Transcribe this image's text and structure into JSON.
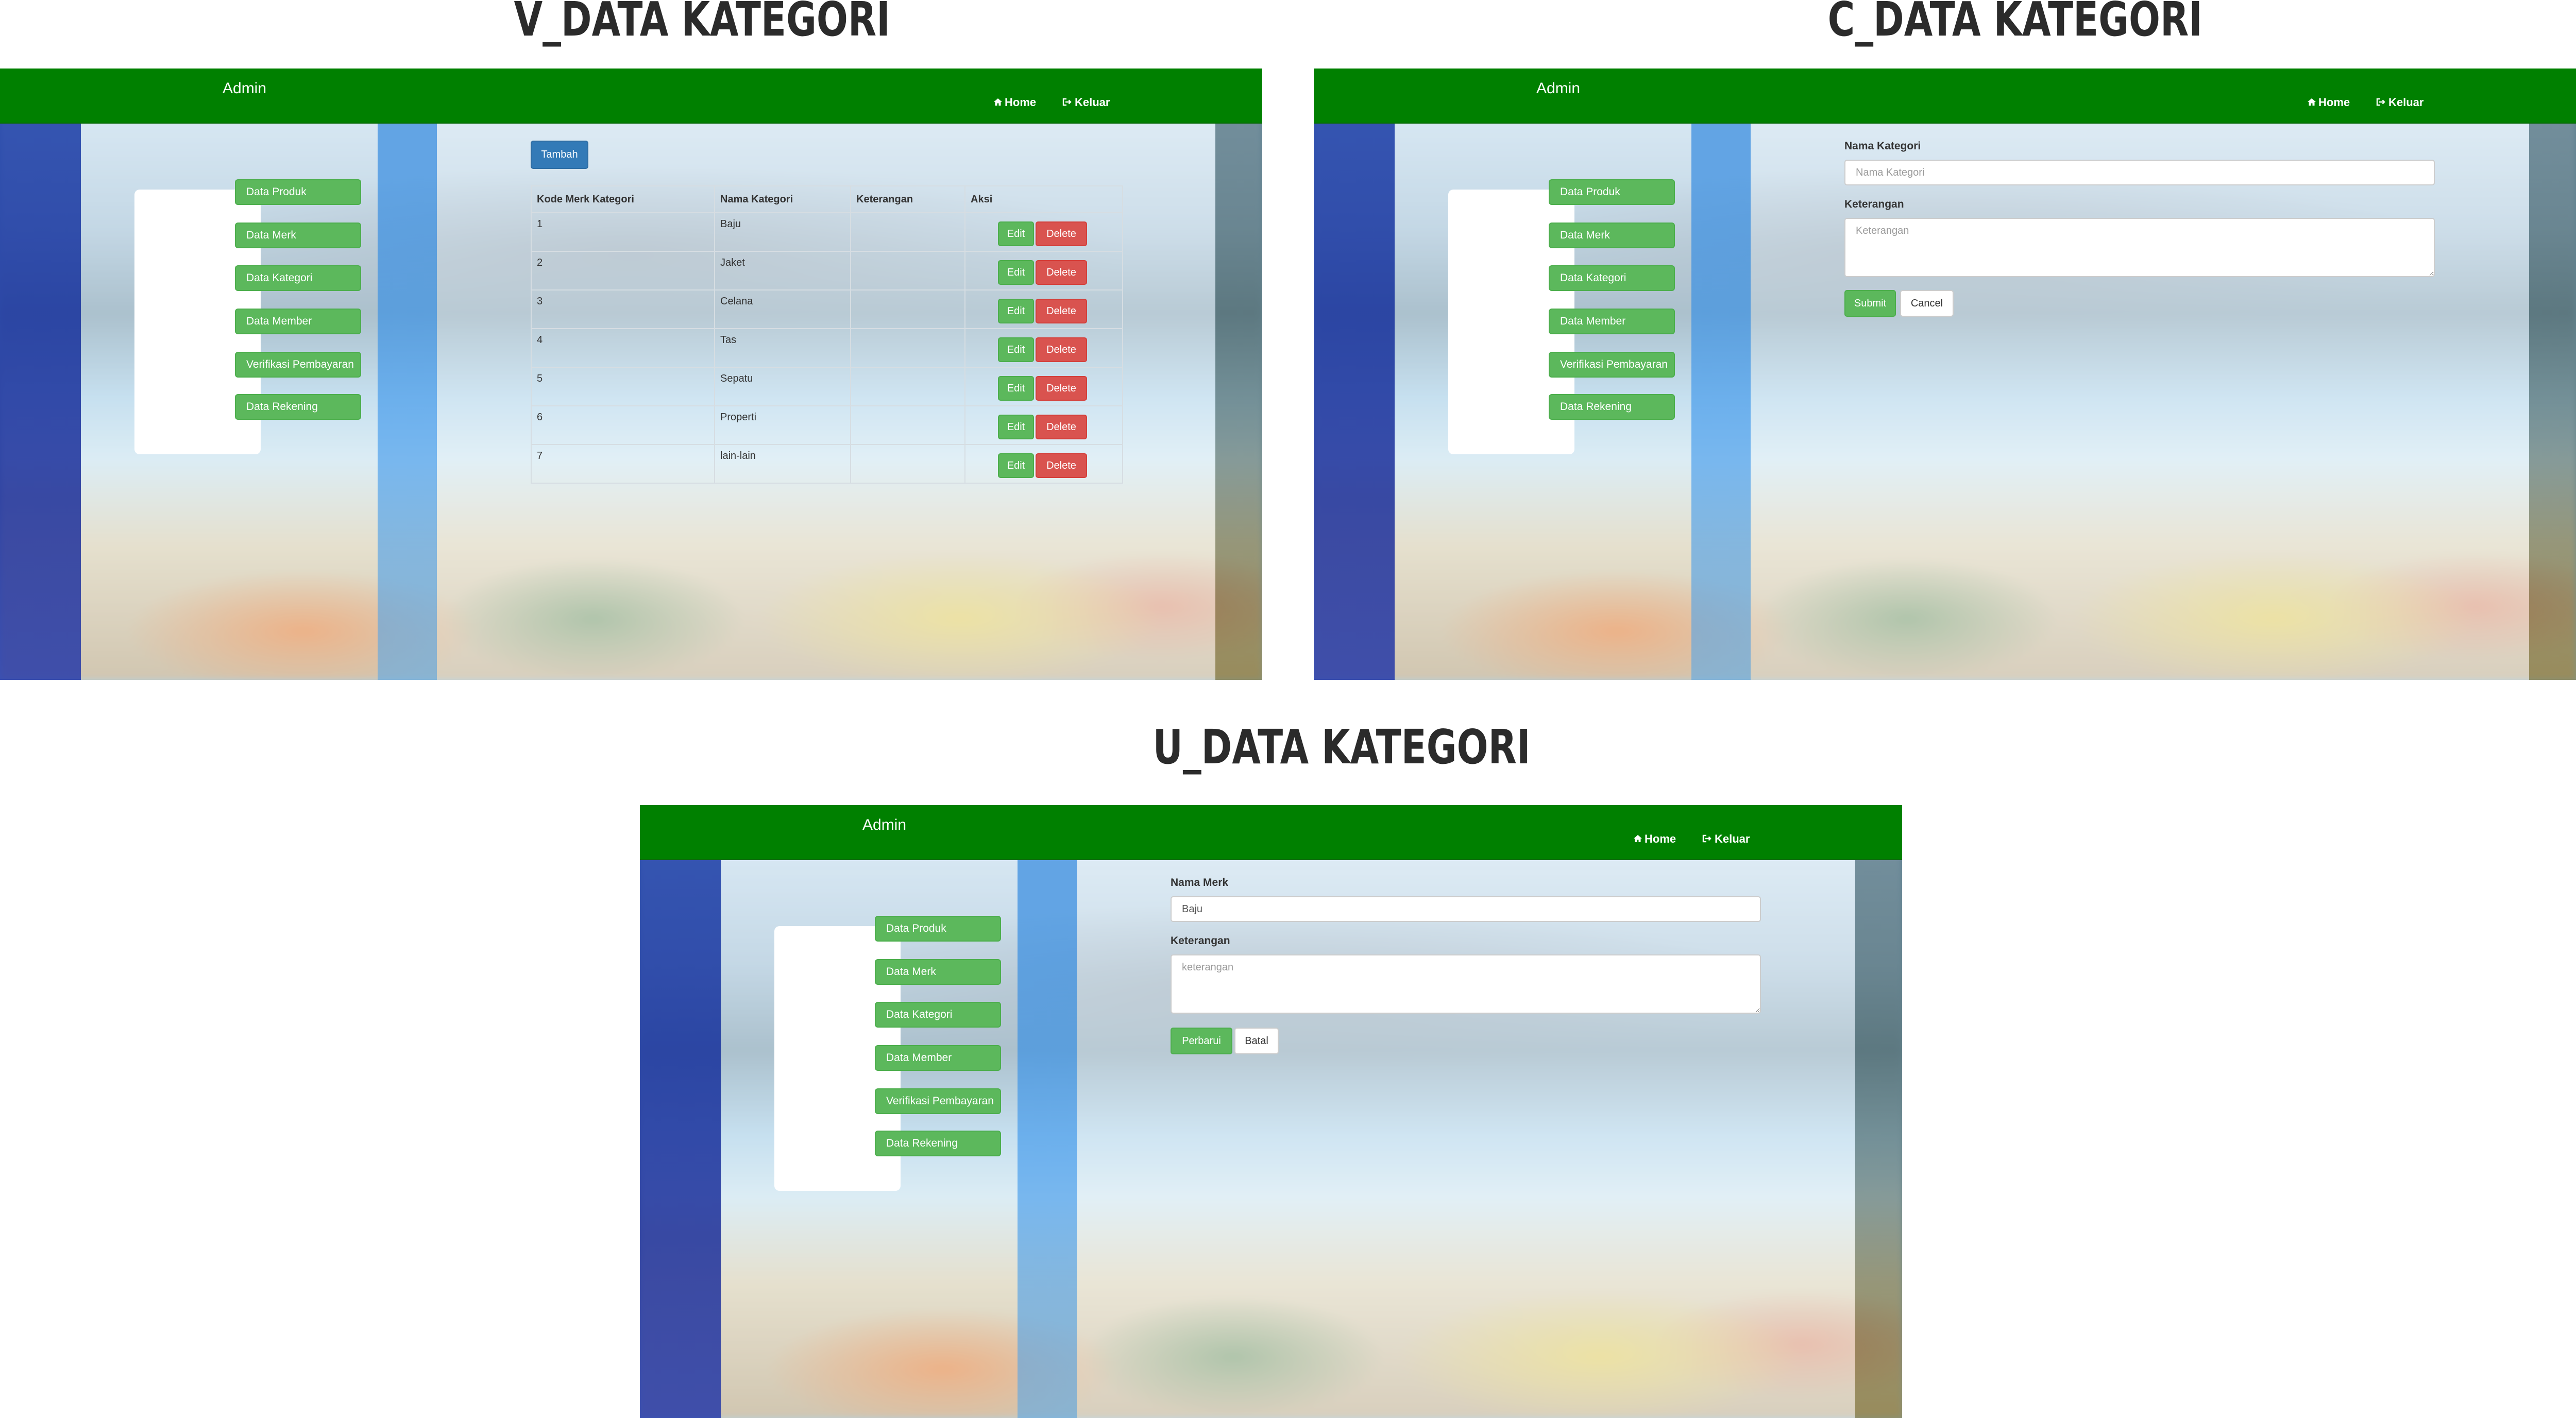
{
  "titles": {
    "v": "V_DATA KATEGORI",
    "c": "C_DATA KATEGORI",
    "u": "U_DATA KATEGORI"
  },
  "navbar": {
    "brand": "Admin",
    "home": "Home",
    "logout": "Keluar"
  },
  "sidebar": {
    "items": [
      {
        "label": "Data Produk"
      },
      {
        "label": "Data Merk"
      },
      {
        "label": "Data Kategori"
      },
      {
        "label": "Data Member"
      },
      {
        "label": "Verifikasi Pembayaran"
      },
      {
        "label": "Data Rekening"
      }
    ]
  },
  "view": {
    "add_button": "Tambah",
    "columns": [
      "Kode Merk Kategori",
      "Nama Kategori",
      "Keterangan",
      "Aksi"
    ],
    "rows": [
      {
        "kode": "1",
        "nama": "Baju",
        "ket": ""
      },
      {
        "kode": "2",
        "nama": "Jaket",
        "ket": ""
      },
      {
        "kode": "3",
        "nama": "Celana",
        "ket": ""
      },
      {
        "kode": "4",
        "nama": "Tas",
        "ket": ""
      },
      {
        "kode": "5",
        "nama": "Sepatu",
        "ket": ""
      },
      {
        "kode": "6",
        "nama": "Properti",
        "ket": ""
      },
      {
        "kode": "7",
        "nama": "lain-lain",
        "ket": ""
      }
    ],
    "edit_label": "Edit",
    "delete_label": "Delete"
  },
  "create": {
    "name_label": "Nama Kategori",
    "name_placeholder": "Nama Kategori",
    "desc_label": "Keterangan",
    "desc_placeholder": "Keterangan",
    "submit": "Submit",
    "cancel": "Cancel"
  },
  "update": {
    "name_label": "Nama Merk",
    "name_value": "Baju",
    "desc_label": "Keterangan",
    "desc_placeholder": "keterangan",
    "submit": "Perbarui",
    "cancel": "Batal"
  },
  "colors": {
    "navbar": "#008000",
    "success": "#5cb85c",
    "danger": "#d9534f",
    "primary": "#337ab7"
  },
  "icons": {
    "home": "home-icon",
    "logout": "logout-icon"
  }
}
